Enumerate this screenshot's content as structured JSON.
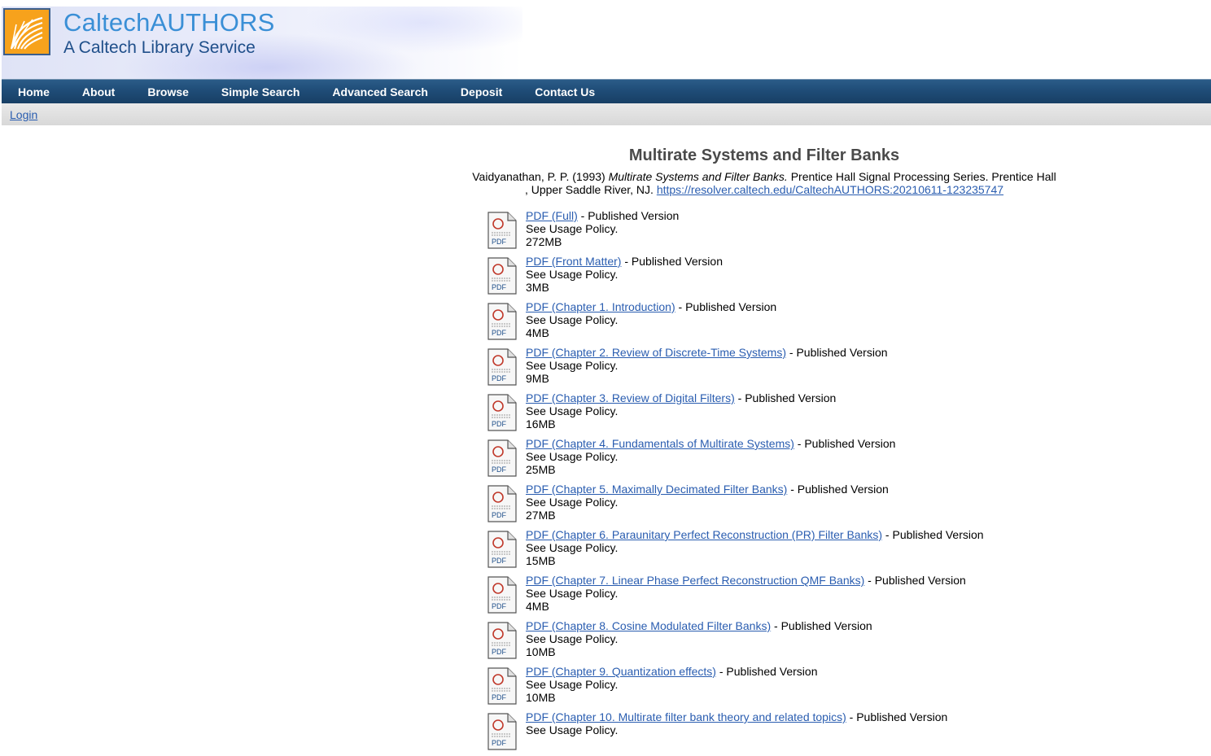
{
  "site": {
    "title": "CaltechAUTHORS",
    "subtitle": "A Caltech Library Service"
  },
  "nav": [
    {
      "label": "Home"
    },
    {
      "label": "About"
    },
    {
      "label": "Browse"
    },
    {
      "label": "Simple Search"
    },
    {
      "label": "Advanced Search"
    },
    {
      "label": "Deposit"
    },
    {
      "label": "Contact Us"
    }
  ],
  "subnav": {
    "login": "Login"
  },
  "record": {
    "title": "Multirate Systems and Filter Banks",
    "citation": {
      "authors_year": "Vaidyanathan, P. P. (1993)",
      "book_title": "Multirate Systems and Filter Banks.",
      "series": "Prentice Hall Signal Processing Series. Prentice Hall , Upper Saddle River, NJ.",
      "url": "https://resolver.caltech.edu/CaltechAUTHORS:20210611-123235747"
    }
  },
  "files": [
    {
      "link": "PDF (Full)",
      "version": " - Published Version",
      "policy": "See Usage Policy.",
      "size": "272MB"
    },
    {
      "link": "PDF (Front Matter)",
      "version": " - Published Version",
      "policy": "See Usage Policy.",
      "size": "3MB"
    },
    {
      "link": "PDF (Chapter 1. Introduction)",
      "version": " - Published Version",
      "policy": "See Usage Policy.",
      "size": "4MB"
    },
    {
      "link": "PDF (Chapter 2. Review of Discrete-Time Systems)",
      "version": " - Published Version",
      "policy": "See Usage Policy.",
      "size": "9MB"
    },
    {
      "link": "PDF (Chapter 3. Review of Digital Filters)",
      "version": " - Published Version",
      "policy": "See Usage Policy.",
      "size": "16MB"
    },
    {
      "link": "PDF (Chapter 4. Fundamentals of Multirate Systems)",
      "version": " - Published Version",
      "policy": "See Usage Policy.",
      "size": "25MB"
    },
    {
      "link": "PDF (Chapter 5. Maximally Decimated Filter Banks)",
      "version": " - Published Version",
      "policy": "See Usage Policy.",
      "size": "27MB"
    },
    {
      "link": "PDF (Chapter 6. Paraunitary Perfect Reconstruction (PR) Filter Banks)",
      "version": " - Published Version",
      "policy": "See Usage Policy.",
      "size": "15MB"
    },
    {
      "link": "PDF (Chapter 7. Linear Phase Perfect Reconstruction QMF Banks)",
      "version": " - Published Version",
      "policy": "See Usage Policy.",
      "size": "4MB"
    },
    {
      "link": "PDF (Chapter 8. Cosine Modulated Filter Banks)",
      "version": " - Published Version",
      "policy": "See Usage Policy.",
      "size": "10MB"
    },
    {
      "link": "PDF (Chapter 9. Quantization effects)",
      "version": " - Published Version",
      "policy": "See Usage Policy.",
      "size": "10MB"
    },
    {
      "link": "PDF (Chapter 10. Multirate filter bank theory and related topics)",
      "version": " - Published Version",
      "policy": "See Usage Policy.",
      "size": ""
    }
  ],
  "icons": {
    "file_icon": "pdf-file-icon",
    "logo": "caltech-library-logo"
  }
}
